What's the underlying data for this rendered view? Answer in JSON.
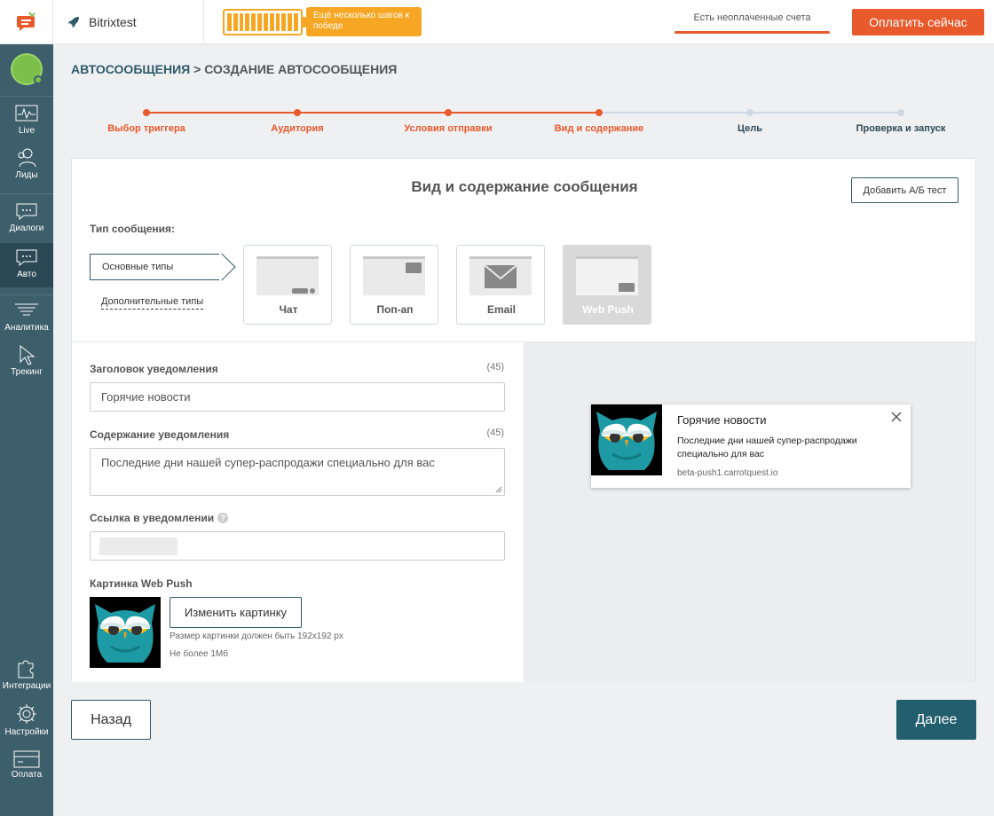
{
  "topbar": {
    "project_name": "Bitrixtest",
    "steps_badge": "Ещё несколько шагов к победе",
    "unpaid": "Есть неоплаченные счета",
    "pay_button": "Оплатить сейчас",
    "battery_level": 1.0
  },
  "sidebar": {
    "items": [
      {
        "label": "Live",
        "icon": "pulse-icon"
      },
      {
        "label": "Лиды",
        "icon": "users-icon"
      },
      {
        "label": "Диалоги",
        "icon": "chat-icon"
      },
      {
        "label": "Авто",
        "icon": "auto-message-icon",
        "active": true
      },
      {
        "label": "Аналитика",
        "icon": "funnel-icon"
      },
      {
        "label": "Трекинг",
        "icon": "cursor-icon"
      },
      {
        "label": "Интеграции",
        "icon": "puzzle-icon"
      },
      {
        "label": "Настройки",
        "icon": "gear-icon"
      },
      {
        "label": "Оплата",
        "icon": "card-icon"
      }
    ]
  },
  "breadcrumb": {
    "root": "АВТОСООБЩЕНИЯ",
    "sep": " > ",
    "current": "СОЗДАНИЕ АВТОСООБЩЕНИЯ"
  },
  "stepper": {
    "steps": [
      {
        "label": "Выбор триггера",
        "done": true
      },
      {
        "label": "Аудитория",
        "done": true
      },
      {
        "label": "Условия отправки",
        "done": true
      },
      {
        "label": "Вид и содержание",
        "done": true
      },
      {
        "label": "Цель",
        "done": false
      },
      {
        "label": "Проверка и запуск",
        "done": false
      }
    ]
  },
  "card": {
    "title": "Вид и содержание сообщения",
    "ab_button": "Добавить А/Б тест",
    "type_label": "Тип сообщения:",
    "basic_types": "Основные типы",
    "extra_types": "Дополнительные типы",
    "message_types": [
      {
        "name": "Чат",
        "selected": false
      },
      {
        "name": "Поп-ап",
        "selected": false
      },
      {
        "name": "Email",
        "selected": false
      },
      {
        "name": "Web Push",
        "selected": true
      }
    ]
  },
  "form": {
    "title_label": "Заголовок уведомления",
    "title_counter": "(45)",
    "title_value": "Горячие новости",
    "body_label": "Содержание уведомления",
    "body_counter": "(45)",
    "body_value": "Последние дни нашей супер-распродажи специально для вас",
    "link_label": "Ссылка в уведомлении",
    "link_help": "?",
    "image_label": "Картинка Web Push",
    "change_image": "Изменить картинку",
    "hint_size": "Размер картинки должен быть 192x192 px",
    "hint_weight": "Не более 1Мб"
  },
  "preview": {
    "title": "Горячие новости",
    "body": "Последние дни нашей супер-распродажи специально для вас",
    "domain": "beta-push1.carrotquest.io"
  },
  "footer": {
    "back": "Назад",
    "next": "Далее"
  },
  "colors": {
    "accent": "#e8592b",
    "primary": "#225e6e",
    "sidebar": "#3d5e6b",
    "battery": "#f6a623"
  }
}
